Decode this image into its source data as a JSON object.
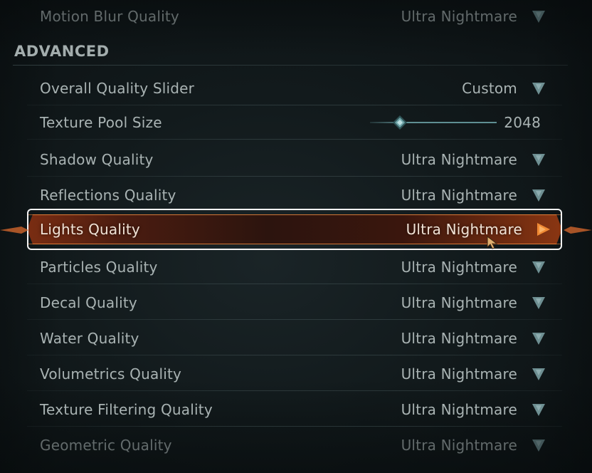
{
  "settings": {
    "top_row": {
      "label": "Motion Blur Quality",
      "value": "Ultra Nightmare"
    },
    "section_title": "ADVANCED",
    "rows": [
      {
        "label": "Overall Quality Slider",
        "value": "Custom"
      },
      {
        "label": "Texture Pool Size",
        "value": "2048",
        "slider_fraction": 0.2
      },
      {
        "label": "Shadow Quality",
        "value": "Ultra Nightmare"
      },
      {
        "label": "Reflections Quality",
        "value": "Ultra Nightmare"
      },
      {
        "label": "Lights Quality",
        "value": "Ultra Nightmare",
        "selected": true
      },
      {
        "label": "Particles Quality",
        "value": "Ultra Nightmare"
      },
      {
        "label": "Decal Quality",
        "value": "Ultra Nightmare"
      },
      {
        "label": "Water Quality",
        "value": "Ultra Nightmare"
      },
      {
        "label": "Volumetrics Quality",
        "value": "Ultra Nightmare"
      },
      {
        "label": "Texture Filtering Quality",
        "value": "Ultra Nightmare"
      },
      {
        "label": "Geometric Quality",
        "value": "Ultra Nightmare"
      }
    ]
  },
  "icons": {
    "dropdown": "chevron-down-icon",
    "selected_arrow": "chevron-right-icon",
    "slider_knob": "diamond-icon",
    "cursor": "mouse-pointer-icon"
  },
  "colors": {
    "text": "#a9b3b3",
    "accent_teal": "#5f8f93",
    "selected_orange": "#e8823a",
    "focus_ring": "#f3f3f3"
  }
}
